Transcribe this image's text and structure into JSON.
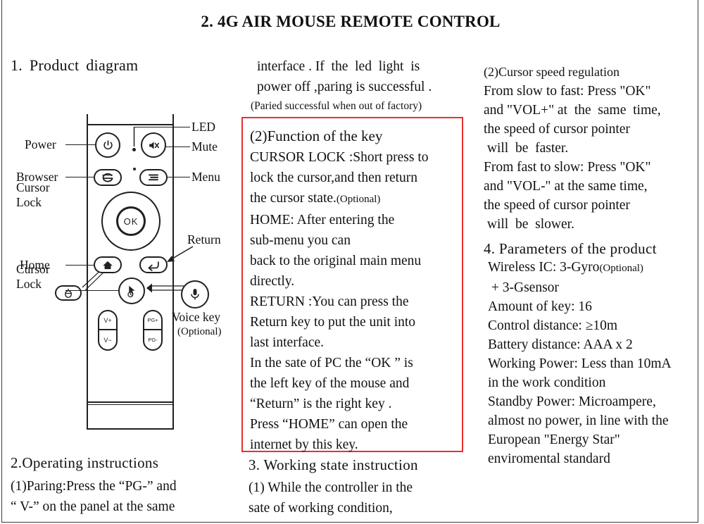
{
  "document": {
    "title": "2. 4G AIR MOUSE REMOTE CONTROL"
  },
  "left_column": {
    "heading": "1. Product  diagram",
    "section2_heading": "2.Operating instructions",
    "section2_lines": [
      "(1)Paring:Press the “PG-” and",
      "“ V-” on the panel at the same"
    ]
  },
  "diagram": {
    "name": "air-mouse-remote",
    "labels": {
      "power": "Power",
      "browser": "Browser",
      "cursor_lock_top": "Cursor\nLock",
      "home": "Home",
      "cursor_lock_bottom": "Cursor\nLock",
      "led": "LED",
      "mute": "Mute",
      "menu": "Menu",
      "return": "Return",
      "voice_key": "Voice key",
      "voice_key_optional": "(Optional)"
    },
    "keys": {
      "ok": "OK",
      "vol_up": "V+",
      "vol_down": "V−",
      "page_up": "PG+",
      "page_down": "PG-"
    }
  },
  "middle_column": {
    "intro_lines": [
      "interface . If  the  led  light  is",
      "power off ,paring is successful .",
      "(Paried successful when out of factory)"
    ],
    "boxed_heading": "(2)Function of the key",
    "boxed_lines": [
      "CURSOR LOCK :Short press to",
      "lock the cursor,and then return",
      "the cursor state.",
      "HOME: After entering the",
      "sub-menu you can",
      "back to the original main menu",
      "directly.",
      "RETURN :You can press the",
      "Return key to put the unit into",
      "last interface.",
      "In the sate of PC the “OK ” is",
      "the left key of the mouse and",
      "“Return” is the right key .",
      "Press “HOME” can open the",
      "internet by this key."
    ],
    "optional_tag": "(Optional)",
    "section3_heading": "3. Working state instruction",
    "section3_lines": [
      "(1) While the controller in the",
      "sate of working condition,"
    ]
  },
  "right_column": {
    "section2_heading": "(2)Cursor speed regulation",
    "section2_lines": [
      "From slow to fast: Press \"OK\"",
      "and \"VOL+\" at  the  same  time,",
      "the speed of cursor pointer",
      " will  be  faster.",
      "From fast to slow: Press \"OK\"",
      "and \"VOL-\" at the same time,",
      "the speed of cursor pointer",
      " will  be  slower."
    ],
    "section4_heading": "4. Parameters of the product",
    "parameters": [
      "Wireless IC: 3-Gyro",
      " + 3-Gsensor",
      "Amount of key: 16",
      "Control distance: ≥10m",
      "Battery distance: AAA x 2",
      "Working Power: Less than 10mA",
      "in the work condition",
      "Standby Power: Microampere,",
      "almost no power, in line with the",
      "European \"Energy Star\"",
      "enviromental standard"
    ],
    "wireless_optional_tag": "(Optional)"
  },
  "colors": {
    "highlight_box": "#e8302f",
    "ink": "#231f20",
    "page_border": "#3a3a3a"
  }
}
